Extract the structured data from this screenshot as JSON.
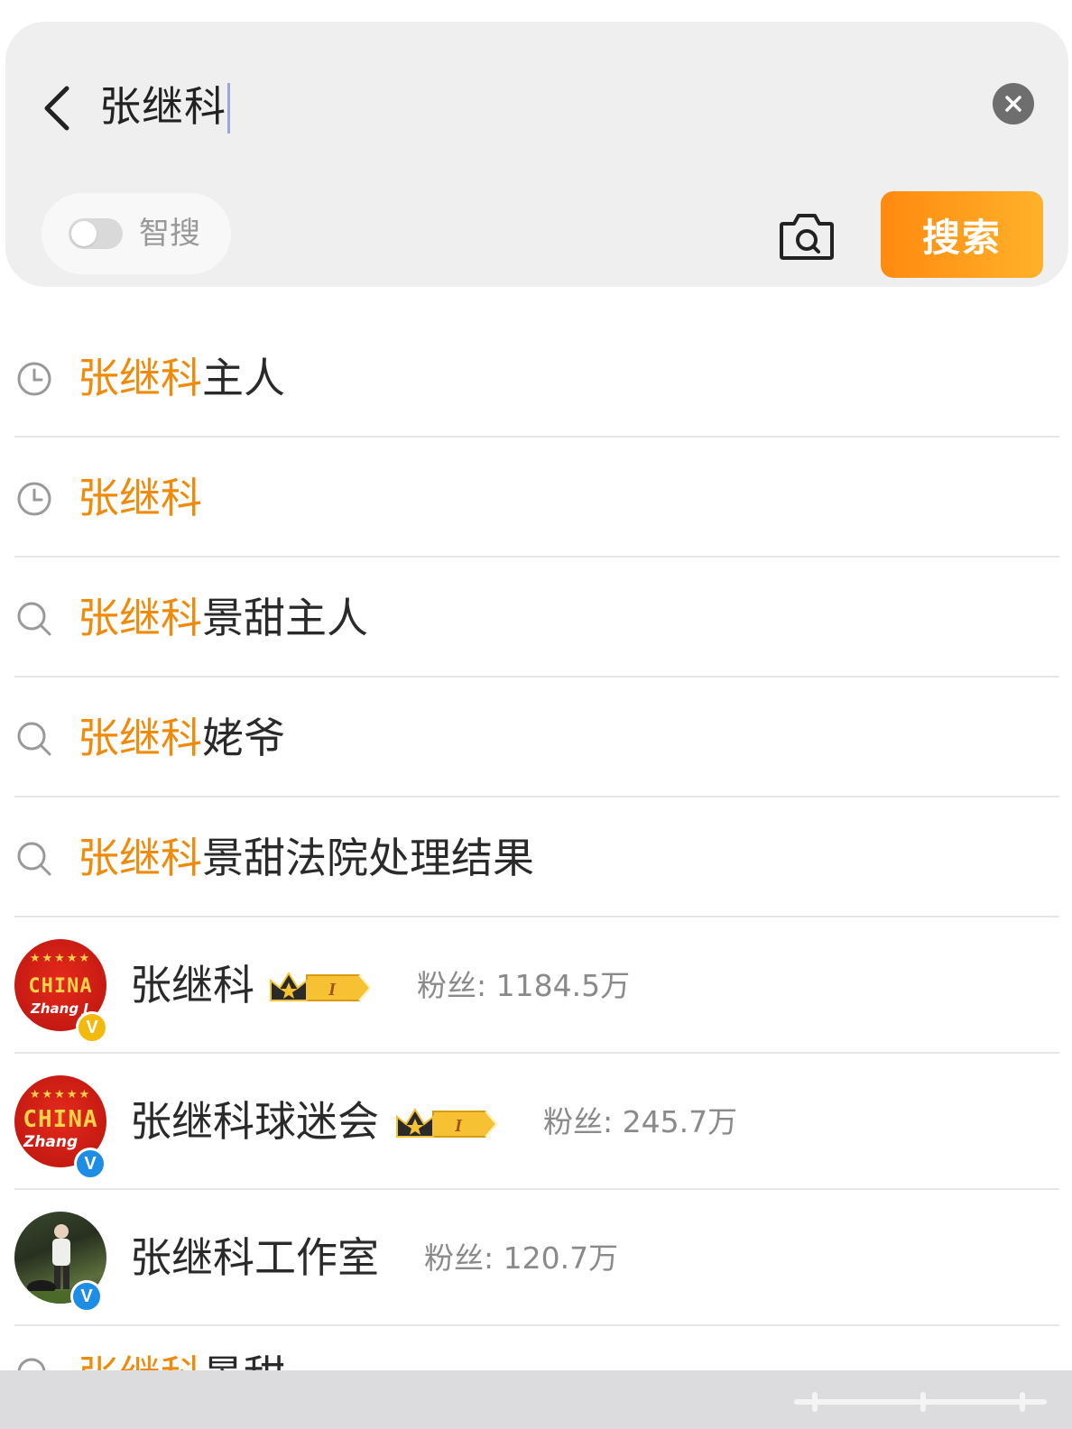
{
  "search": {
    "query": "张继科",
    "smart_label": "智搜",
    "smart_enabled": false,
    "search_button_label": "搜索"
  },
  "suggestions": [
    {
      "type": "history",
      "icon": "clock-icon",
      "highlight": "张继科",
      "rest": "主人"
    },
    {
      "type": "history",
      "icon": "clock-icon",
      "highlight": "张继科",
      "rest": ""
    },
    {
      "type": "search",
      "icon": "search-icon",
      "highlight": "张继科",
      "rest": "景甜主人"
    },
    {
      "type": "search",
      "icon": "search-icon",
      "highlight": "张继科",
      "rest": "姥爷"
    },
    {
      "type": "search",
      "icon": "search-icon",
      "highlight": "张继科",
      "rest": "景甜法院处理结果"
    }
  ],
  "users": [
    {
      "name": "张继科",
      "fans": "粉丝: 1184.5万",
      "verified": "gold",
      "vip_level": "I",
      "avatar_text": {
        "stars": "★★★★★",
        "line1": "CHINA",
        "line2": "Zhang J"
      }
    },
    {
      "name": "张继科球迷会",
      "fans": "粉丝: 245.7万",
      "verified": "blue",
      "vip_level": "I",
      "avatar_text": {
        "stars": "★★★★★",
        "line1": "CHINA",
        "line2": "Zhang"
      }
    },
    {
      "name": "张继科工作室",
      "fans": "粉丝: 120.7万",
      "verified": "blue",
      "vip_level": null
    }
  ],
  "partial_row": {
    "highlight": "张继科",
    "rest": "景甜"
  },
  "colors": {
    "highlight": "#f08a0a",
    "search_button": "#ff9a1a",
    "panel": "#efefef"
  }
}
